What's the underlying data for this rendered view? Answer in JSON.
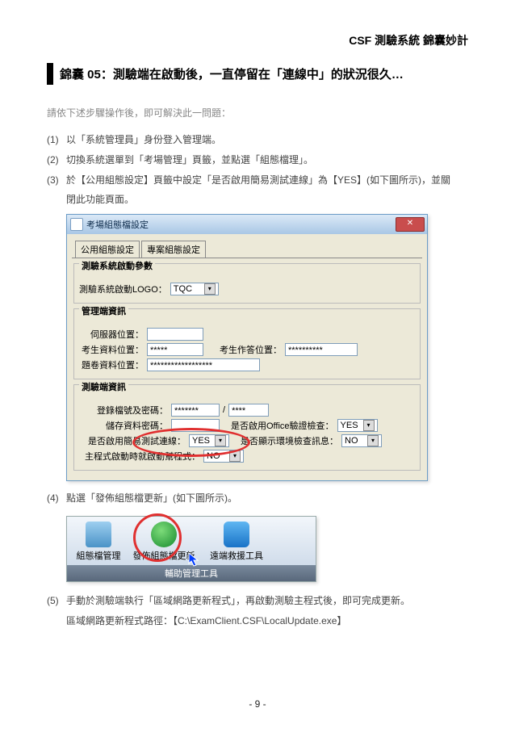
{
  "header": "CSF 測驗系統 錦囊妙計",
  "tip": {
    "prefix": "錦囊 05：",
    "title": "測驗端在啟動後，一直停留在「連線中」的狀況很久…"
  },
  "intro": "請依下述步驟操作後，即可解決此一問題：",
  "steps": {
    "s1": "以「系統管理員」身份登入管理端。",
    "s2": "切換系統選單到「考場管理」頁籤，並點選「組態檔理」。",
    "s3": "於【公用組態設定】頁籤中設定「是否啟用簡易測試連線」為【YES】(如下圖所示)，並關",
    "s3b": "閉此功能頁面。",
    "s4": "點選「發佈組態檔更新」(如下圖所示)。",
    "s5": "手動於測驗端執行「區域網路更新程式」，再啟動測驗主程式後，即可完成更新。",
    "s5b": "區域網路更新程式路徑：【C:\\ExamClient.CSF\\LocalUpdate.exe】"
  },
  "dialog": {
    "title": "考場組態檔設定",
    "close": "✕",
    "tabs": {
      "t1": "公用組態設定",
      "t2": "專案組態設定"
    },
    "group_startup": {
      "title": "測驗系統啟動參數",
      "logo_label": "測驗系統啟動LOGO：",
      "logo_value": "TQC"
    },
    "group_mgmt": {
      "title": "管理端資訊",
      "server_label": "伺服器位置：",
      "server_value": "",
      "datadir_label": "考生資料位置：",
      "datadir_value": "*****",
      "ansdir_label": "考生作答位置：",
      "ansdir_value": "**********",
      "tpldir_label": "題卷資料位置：",
      "tpldir_value": "******************"
    },
    "group_client": {
      "title": "測驗端資訊",
      "reg_label": "登錄檔號及密碼：",
      "reg_v1": "*******",
      "reg_sep": "/",
      "reg_v2": "****",
      "storage_label": "儲存資料密碼：",
      "office_label": "是否啟用Office驗證檢查：",
      "office_value": "YES",
      "simpleconn_label": "是否啟用簡易測試連線：",
      "simpleconn_value": "YES",
      "envmsg_label": "是否顯示環境檢查訊息：",
      "envmsg_value": "NO",
      "mainstart_label": "主程式啟動時就啟動幫程式：",
      "mainstart_value": "NO"
    }
  },
  "toolbar": {
    "btn1": "組態檔管理",
    "btn2": "發佈組態檔更新",
    "btn3": "遠端救援工具",
    "caption": "輔助管理工具"
  },
  "footer": "- 9 -"
}
